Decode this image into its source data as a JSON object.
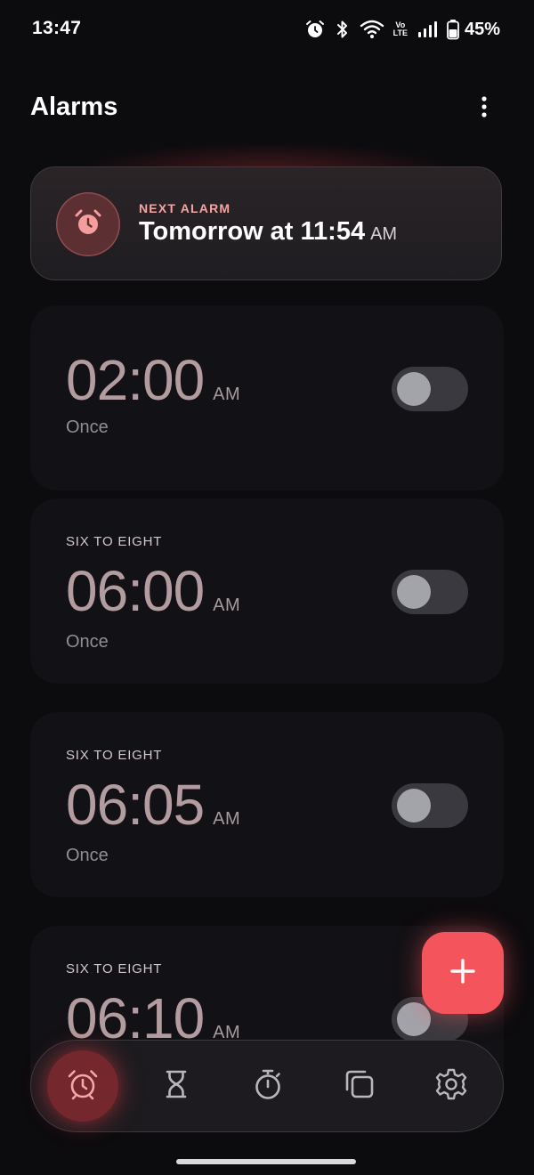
{
  "status_bar": {
    "time": "13:47",
    "volte_top": "Vo",
    "volte_bottom": "LTE",
    "battery": "45%",
    "icons": [
      "alarm-icon",
      "bluetooth-icon",
      "wifi-icon",
      "volte-icon",
      "signal-icon",
      "battery-icon"
    ]
  },
  "header": {
    "title": "Alarms",
    "menu_icon": "more-vert-icon"
  },
  "next_alarm": {
    "label": "NEXT ALARM",
    "time": "Tomorrow at 11:54",
    "ampm": "AM",
    "icon": "alarm-clock-icon"
  },
  "alarms": [
    {
      "label": "",
      "time": "02:00",
      "ampm": "AM",
      "repeat": "Once",
      "enabled": false
    },
    {
      "label": "SIX TO EIGHT",
      "time": "06:00",
      "ampm": "AM",
      "repeat": "Once",
      "enabled": false
    },
    {
      "label": "SIX TO EIGHT",
      "time": "06:05",
      "ampm": "AM",
      "repeat": "Once",
      "enabled": false
    },
    {
      "label": "SIX TO EIGHT",
      "time": "06:10",
      "ampm": "AM",
      "repeat": "",
      "enabled": false
    }
  ],
  "fab": {
    "icon": "plus-icon"
  },
  "nav": {
    "items": [
      {
        "icon": "alarm-clock-icon",
        "active": true
      },
      {
        "icon": "hourglass-icon",
        "active": false
      },
      {
        "icon": "stopwatch-icon",
        "active": false
      },
      {
        "icon": "world-clock-icon",
        "active": false
      },
      {
        "icon": "settings-icon",
        "active": false
      }
    ]
  },
  "colors": {
    "accent": "#f4555c",
    "background": "#0c0b0e",
    "card": "#121115",
    "next_label": "#f3a6a3"
  }
}
